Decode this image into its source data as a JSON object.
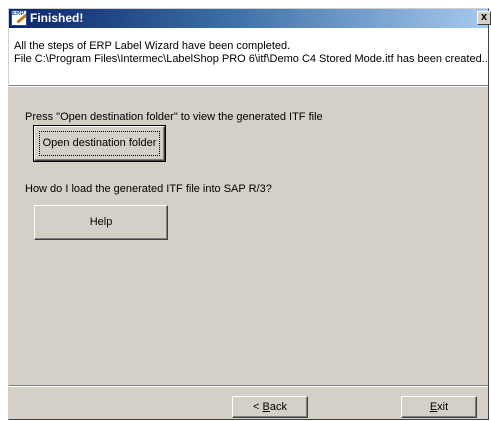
{
  "window": {
    "title": "Finished!",
    "title_icon_text": "ERP",
    "close_glyph": "x"
  },
  "header": {
    "line1": "All the steps of ERP Label Wizard have been completed.",
    "line2": "File C:\\Program Files\\Intermec\\LabelShop PRO 6\\itf\\Demo C4 Stored Mode.itf has been created.."
  },
  "body": {
    "open_prompt": "Press \"Open destination folder\" to view the generated ITF file",
    "open_button": "Open destination folder",
    "help_prompt": "How do I load the generated ITF file into SAP R/3?",
    "help_button": "Help"
  },
  "footer": {
    "back_prefix": "< ",
    "back_mnemonic": "B",
    "back_rest": "ack",
    "exit_mnemonic": "E",
    "exit_rest": "xit"
  },
  "colors": {
    "face": "#d4d0c8",
    "title_start": "#0a246a",
    "title_end": "#a6caf0"
  },
  "icons": [
    "erp-wizard-icon",
    "close-icon"
  ]
}
